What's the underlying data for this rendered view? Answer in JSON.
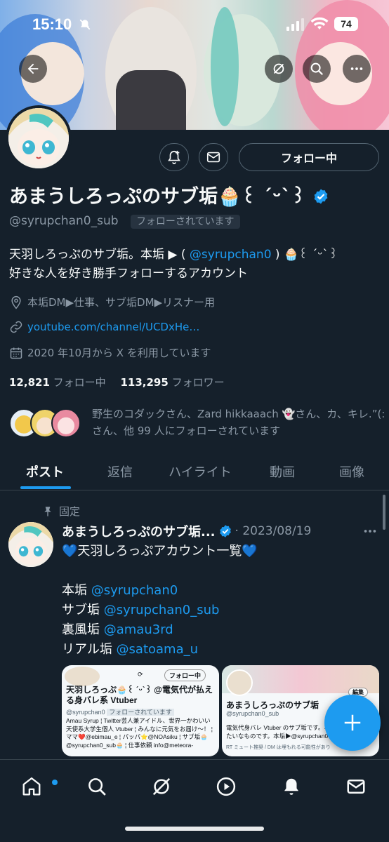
{
  "status_bar": {
    "time": "15:10",
    "battery": "74"
  },
  "profile": {
    "name": "あまうしろっぷのサブ垢🧁꒰ ˊᵕˋ꒱",
    "handle": "@syrupchan0_sub",
    "follows_you": "フォローされています",
    "follow_button": "フォロー中",
    "bio_line1_prefix": "天羽しろっぷのサブ垢。本垢 ▶ ( ",
    "bio_line1_mention": "@syrupchan0",
    "bio_line1_suffix": " ) 🧁꒰ ˊᵕˋ꒱",
    "bio_line2": "好きな人を好き勝手フォローするアカウント",
    "location": "本垢DM▶仕事、サブ垢DM▶リスナー用",
    "website": "youtube.com/channel/UCDxHe…",
    "joined": "2020 年10月から X を利用しています",
    "following_count": "12,821",
    "following_label": "フォロー中",
    "followers_count": "113,295",
    "followers_label": "フォロワー",
    "followed_by_text": "野生のコダックさん、Zard hikkaaach 👻さん、カ、キレ.”(:さん、他 99 人にフォローされています"
  },
  "tabs": [
    {
      "label": "ポスト"
    },
    {
      "label": "返信"
    },
    {
      "label": "ハイライト"
    },
    {
      "label": "動画"
    },
    {
      "label": "画像"
    }
  ],
  "pinned_post": {
    "pinned_label": "固定",
    "author": "あまうしろっぷのサブ垢...",
    "date": "· 2023/08/19",
    "line1": "💙天羽しろっぷアカウント一覧💙",
    "accounts": [
      {
        "label": "本垢 ",
        "handle": "@syrupchan0"
      },
      {
        "label": "サブ垢 ",
        "handle": "@syrupchan0_sub"
      },
      {
        "label": "裏風垢 ",
        "handle": "@amau3rd"
      },
      {
        "label": "リアル垢 ",
        "handle": "@satoama_u"
      }
    ]
  },
  "image_card_left": {
    "follow_btn": "フォロー中",
    "title": "天羽しろっぷ🧁꒰ ˊᵕˋ꒱ @電気代が払える身バレ系 Vtuber",
    "handle": "@syrupchan0",
    "follows_you": "フォローされています",
    "bio": "Amau Syrup ¦ Twitter芸人兼アイドル、世界一かわいい天使系大学生個人 Vtuber ¦ みんなに元気をお届け〜！ ¦ ママ❤️@ebimau_e ¦ パッパ⭐@NOAsiku ¦ サブ垢🧁@syrupchan0_sub🧁 ¦ 仕事依頼 info@meteora-"
  },
  "image_card_right": {
    "edit_btn": "編集",
    "title": "あまうしろっぷのサブ垢",
    "handle": "@syrupchan0_sub",
    "bio": "電気代身バレ Vtuber のサブ垢です。ネ たいなものです。本垢▶@syrupchan0",
    "footer": "RT ミュート推奨 / DM は埋もれる可能性があります"
  },
  "colors": {
    "accent": "#1d9bf0",
    "background": "#15202b",
    "muted": "#8b98a5"
  },
  "icons": [
    "back-icon",
    "no-retweets-icon",
    "search-icon",
    "more-icon",
    "notify-add-icon",
    "mail-icon",
    "location-icon",
    "link-icon",
    "calendar-icon",
    "pin-icon",
    "plus-icon",
    "home-icon",
    "explore-icon",
    "grok-icon",
    "video-icon",
    "bell-icon",
    "messages-icon"
  ]
}
